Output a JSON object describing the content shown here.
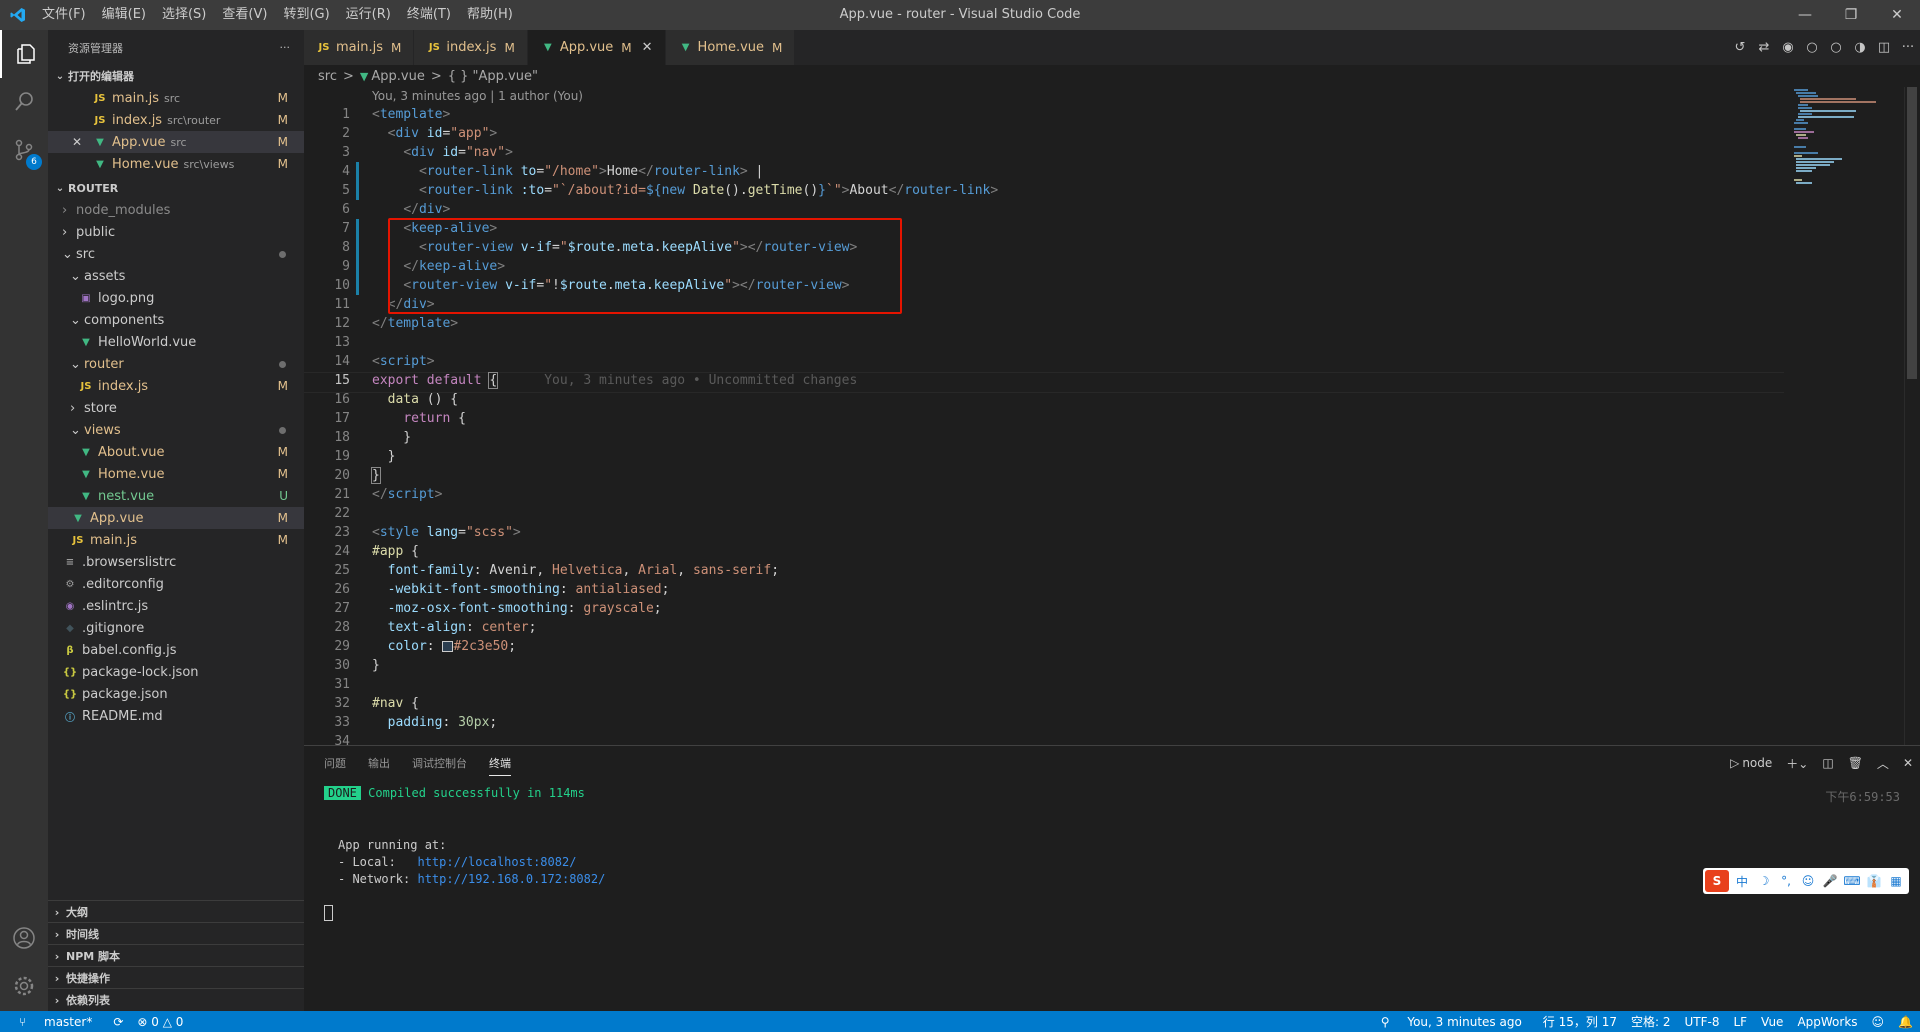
{
  "window": {
    "title": "App.vue - router - Visual Studio Code",
    "menu": [
      "文件(F)",
      "编辑(E)",
      "选择(S)",
      "查看(V)",
      "转到(G)",
      "运行(R)",
      "终端(T)",
      "帮助(H)"
    ]
  },
  "activity": {
    "scm_badge": "6"
  },
  "sidebar": {
    "title": "资源管理器",
    "open_editors_label": "打开的编辑器",
    "open_editors": [
      {
        "icon": "JS",
        "name": "main.js",
        "hint": "src",
        "badge": "M"
      },
      {
        "icon": "JS",
        "name": "index.js",
        "hint": "src\\router",
        "badge": "M"
      },
      {
        "icon": "V",
        "name": "App.vue",
        "hint": "src",
        "badge": "M",
        "close": "✕"
      },
      {
        "icon": "V",
        "name": "Home.vue",
        "hint": "src\\views",
        "badge": "M"
      }
    ],
    "project_label": "ROUTER",
    "tree": [
      {
        "name": "node_modules",
        "badge": ""
      },
      {
        "name": "public",
        "badge": ""
      },
      {
        "name": "src",
        "badge": ""
      },
      {
        "name": "assets",
        "badge": ""
      },
      {
        "name": "logo.png",
        "badge": ""
      },
      {
        "name": "components",
        "badge": ""
      },
      {
        "name": "HelloWorld.vue",
        "badge": ""
      },
      {
        "name": "router",
        "badge": ""
      },
      {
        "name": "index.js",
        "badge": "M"
      },
      {
        "name": "store",
        "badge": ""
      },
      {
        "name": "views",
        "badge": ""
      },
      {
        "name": "About.vue",
        "badge": "M"
      },
      {
        "name": "Home.vue",
        "badge": "M"
      },
      {
        "name": "nest.vue",
        "badge": "U"
      },
      {
        "name": "App.vue",
        "badge": "M"
      },
      {
        "name": "main.js",
        "badge": "M"
      },
      {
        "name": ".browserslistrc",
        "badge": ""
      },
      {
        "name": ".editorconfig",
        "badge": ""
      },
      {
        "name": ".eslintrc.js",
        "badge": ""
      },
      {
        "name": ".gitignore",
        "badge": ""
      },
      {
        "name": "babel.config.js",
        "badge": ""
      },
      {
        "name": "package-lock.json",
        "badge": ""
      },
      {
        "name": "package.json",
        "badge": ""
      },
      {
        "name": "README.md",
        "badge": ""
      }
    ],
    "bottom_sections": [
      "大纲",
      "时间线",
      "NPM 脚本",
      "快捷操作",
      "依赖列表"
    ]
  },
  "tabs": [
    {
      "icon": "JS",
      "name": "main.js",
      "mark": "M"
    },
    {
      "icon": "JS",
      "name": "index.js",
      "mark": "M"
    },
    {
      "icon": "V",
      "name": "App.vue",
      "mark": "M",
      "close": "✕"
    },
    {
      "icon": "V",
      "name": "Home.vue",
      "mark": "M"
    }
  ],
  "breadcrumb": {
    "folder": "src",
    "sep": ">",
    "file": "App.vue",
    "symbol": "{ } \"App.vue\""
  },
  "codelens": "You, 3 minutes ago | 1 author (You)",
  "editor": {
    "line_numbers": [
      "1",
      "2",
      "3",
      "4",
      "5",
      "6",
      "7",
      "8",
      "9",
      "10",
      "11",
      "12",
      "13",
      "14",
      "15",
      "16",
      "17",
      "18",
      "19",
      "20",
      "21",
      "22",
      "23",
      "24",
      "25",
      "26",
      "27",
      "28",
      "29",
      "30",
      "31",
      "32",
      "33",
      "34"
    ],
    "current_line": "15",
    "blame_text": "You, 3 minutes ago • Uncommitted changes"
  },
  "panel": {
    "tabs": [
      "问题",
      "输出",
      "调试控制台",
      "终端"
    ],
    "terminal_name": "node",
    "done_label": "DONE",
    "compiled_text": "Compiled successfully in 114ms",
    "time": "下午6:59:53",
    "app_running": "App running at:",
    "local_label": "- Local:   ",
    "local_url": "http://localhost:8082/",
    "network_label": "- Network: ",
    "network_url": "http://192.168.0.172:8082/"
  },
  "statusbar": {
    "branch": "master*",
    "problems": "⊗ 0 △ 0",
    "blame": "You, 3 minutes ago",
    "position": "行 15，列 17",
    "spaces": "空格: 2",
    "encoding": "UTF-8",
    "eol": "LF",
    "language": "Vue",
    "extension": "AppWorks"
  },
  "ime": {
    "chars": [
      "中",
      "☽",
      "°,",
      "☺",
      "🎤",
      "⌨",
      "👔",
      "▦"
    ]
  },
  "colors": {
    "accent": "#007acc",
    "highlight_box": "#e51400",
    "modified": "#e2c08d",
    "untracked": "#73c991"
  }
}
